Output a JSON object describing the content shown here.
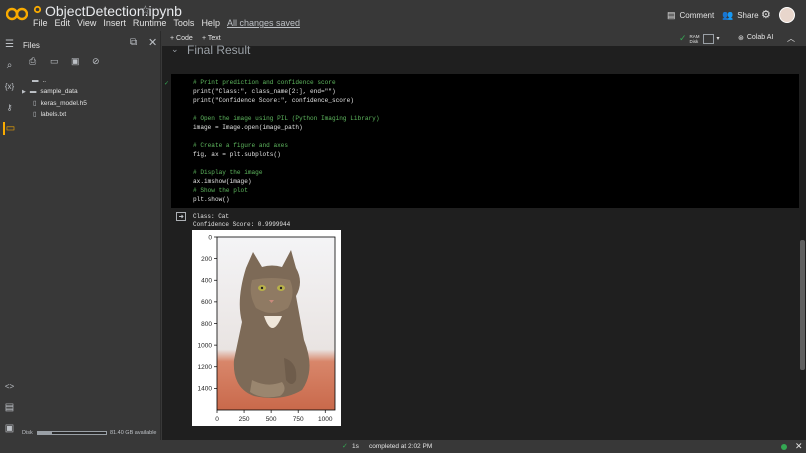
{
  "app": {
    "notebook_title": "ObjectDetection.ipynb",
    "menus": [
      "File",
      "Edit",
      "View",
      "Insert",
      "Runtime",
      "Tools",
      "Help"
    ],
    "saved_status": "All changes saved",
    "comment_label": "Comment",
    "share_label": "Share",
    "ram_label": "RAM",
    "disk_label": "Disk",
    "colab_ai_label": "Colab AI"
  },
  "toolbar": {
    "add_code": "+ Code",
    "add_text": "+ Text"
  },
  "files": {
    "title": "Files",
    "parent": "..",
    "items": [
      {
        "name": "sample_data",
        "type": "folder"
      },
      {
        "name": "keras_model.h5",
        "type": "file"
      },
      {
        "name": "labels.txt",
        "type": "file"
      }
    ],
    "disk_label": "Disk",
    "disk_value": "81.40 GB available",
    "disk_used_fraction": 0.2
  },
  "section": {
    "title": "Final Result"
  },
  "code_lines": [
    "# Print prediction and confidence score",
    "print(\"Class:\", class_name[2:], end=\"\")",
    "print(\"Confidence Score:\", confidence_score)",
    "",
    "# Open the image using PIL (Python Imaging Library)",
    "image = Image.open(image_path)",
    "",
    "# Create a figure and axes",
    "fig, ax = plt.subplots()",
    "",
    "# Display the image",
    "ax.imshow(image)",
    "# Show the plot",
    "plt.show()"
  ],
  "output": {
    "class_line": "Class: Cat",
    "confidence_line": "Confidence Score: 0.9999944"
  },
  "plot": {
    "y_ticks": [
      "0",
      "200",
      "400",
      "600",
      "800",
      "1000",
      "1200",
      "1400"
    ],
    "x_ticks": [
      "0",
      "250",
      "500",
      "750",
      "1000"
    ]
  },
  "status": {
    "duration": "1s",
    "message": "completed at 2:02 PM"
  },
  "colors": {
    "accent": "#f9ab00",
    "ok": "#34a853"
  }
}
